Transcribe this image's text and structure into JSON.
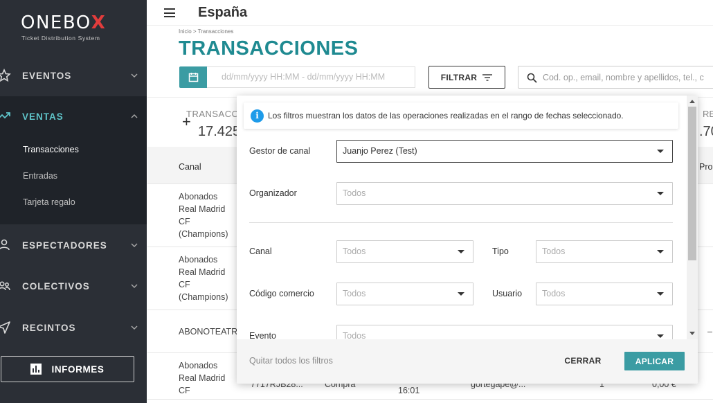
{
  "sidebar": {
    "logo": {
      "text": "ONEBO",
      "x_letter": "X",
      "tagline": "Ticket Distribution System"
    },
    "items": [
      {
        "label": "EVENTOS",
        "icon": "star-icon"
      },
      {
        "label": "VENTAS",
        "icon": "trend-icon",
        "active": true
      },
      {
        "label": "ESPECTADORES",
        "icon": "person-icon"
      },
      {
        "label": "COLECTIVOS",
        "icon": "group-icon"
      },
      {
        "label": "RECINTOS",
        "icon": "location-icon"
      }
    ],
    "subitems": [
      "Transacciones",
      "Entradas",
      "Tarjeta regalo"
    ],
    "informes_label": "INFORMES"
  },
  "topbar": {
    "title": "España"
  },
  "breadcrumb": "Inicio > Transacciones",
  "page_title": "TRANSACCIONES",
  "date_range": {
    "placeholder": "dd/mm/yyyy HH:MM  -  dd/mm/yyyy HH:MM"
  },
  "filter_button": "FILTRAR",
  "search": {
    "placeholder": "Cod. op., email, nombre y apellidos, tel., c"
  },
  "summary": {
    "left": {
      "plus": "+",
      "label": "TRANSACC",
      "value": "17.425"
    },
    "right": {
      "label": "RE",
      "value": ".70"
    }
  },
  "table": {
    "headers": {
      "canal": "Canal",
      "right": "Pro"
    },
    "rows": [
      {
        "canal": [
          "Abonados",
          "Real Madrid",
          "CF",
          "(Champions)"
        ]
      },
      {
        "canal": [
          "Abonados",
          "Real Madrid",
          "CF",
          "(Champions)"
        ]
      },
      {
        "canal": [
          "ABONOTEATR"
        ],
        "extra": "–"
      },
      {
        "canal": [
          "Abonados",
          "Real Madrid",
          "CF"
        ],
        "codigo": "7717RJB28...",
        "tipo": "Compra",
        "hora": "16:01",
        "email": "gortegape@...",
        "cantidad": "1",
        "importe": "0,00 €"
      }
    ]
  },
  "modal": {
    "info": "Los filtros muestran los datos de las operaciones realizadas en el rango de fechas seleccionado.",
    "fields": {
      "gestor": {
        "label": "Gestor de canal",
        "value": "Juanjo Perez (Test)"
      },
      "organizador": {
        "label": "Organizador",
        "value": "Todos"
      },
      "canal": {
        "label": "Canal",
        "value": "Todos"
      },
      "tipo": {
        "label": "Tipo",
        "value": "Todos"
      },
      "codigo": {
        "label": "Código comercio",
        "value": "Todos"
      },
      "usuario": {
        "label": "Usuario",
        "value": "Todos"
      },
      "evento": {
        "label": "Evento",
        "value": "Todos"
      }
    },
    "footer": {
      "clear": "Quitar todos los filtros",
      "close": "CERRAR",
      "apply": "APLICAR"
    }
  },
  "colors": {
    "accent": "#3b9ca3",
    "title": "#1f8a91",
    "sidebar": "#2b2f36",
    "logo_x": "#e33c3c",
    "info": "#1e9be9"
  }
}
